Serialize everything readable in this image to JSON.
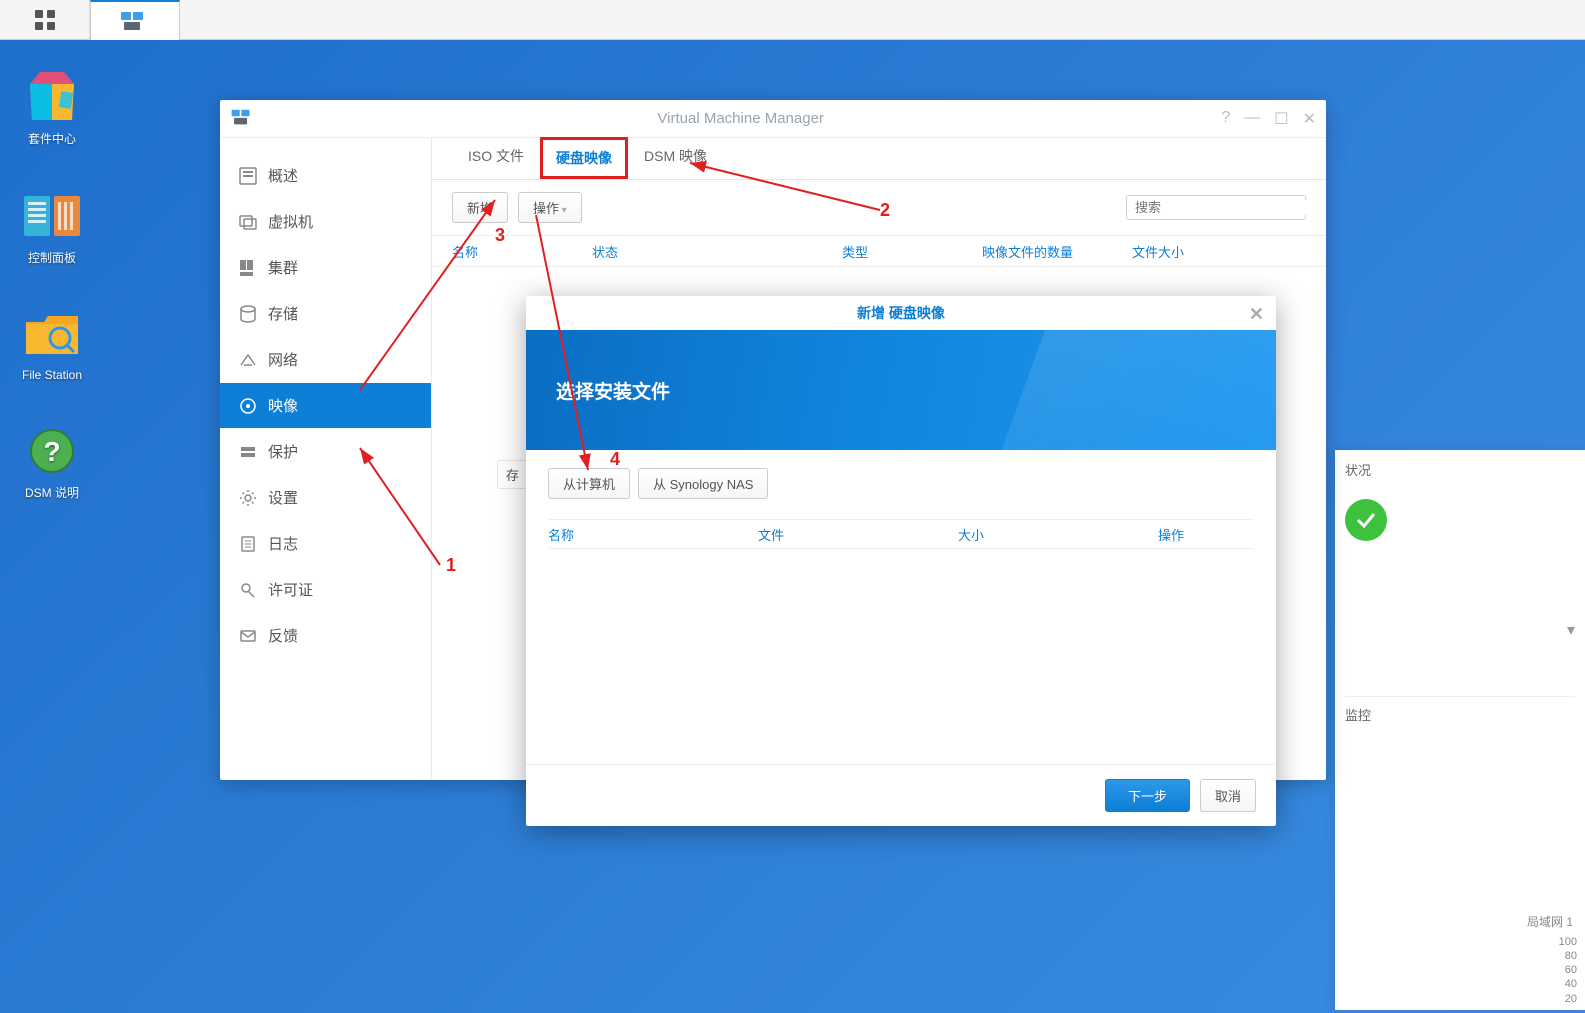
{
  "taskbar": {
    "apps_label": "Apps",
    "vmm_label": "VMM"
  },
  "desktop": {
    "package_center": "套件中心",
    "control_panel": "控制面板",
    "file_station": "File Station",
    "dsm_help": "DSM 说明"
  },
  "window": {
    "title": "Virtual Machine Manager",
    "icon_name": "vmm-app-icon"
  },
  "sidebar": {
    "items": [
      {
        "label": "概述",
        "icon": "overview-icon"
      },
      {
        "label": "虚拟机",
        "icon": "vm-icon"
      },
      {
        "label": "集群",
        "icon": "cluster-icon"
      },
      {
        "label": "存储",
        "icon": "storage-icon"
      },
      {
        "label": "网络",
        "icon": "network-icon"
      },
      {
        "label": "映像",
        "icon": "image-icon",
        "active": true
      },
      {
        "label": "保护",
        "icon": "protect-icon"
      },
      {
        "label": "设置",
        "icon": "settings-icon"
      },
      {
        "label": "日志",
        "icon": "log-icon"
      },
      {
        "label": "许可证",
        "icon": "license-icon"
      },
      {
        "label": "反馈",
        "icon": "feedback-icon"
      }
    ]
  },
  "tabs": [
    {
      "label": "ISO 文件"
    },
    {
      "label": "硬盘映像",
      "active": true,
      "highlighted": true
    },
    {
      "label": "DSM 映像"
    }
  ],
  "toolbar": {
    "add_label": "新增",
    "action_label": "操作",
    "search_placeholder": "搜索"
  },
  "table_columns": [
    "名称",
    "状态",
    "类型",
    "映像文件的数量",
    "文件大小"
  ],
  "storage_peek": "存",
  "modal": {
    "title": "新增 硬盘映像",
    "hero_title": "选择安装文件",
    "from_computer": "从计算机",
    "from_nas": "从 Synology NAS",
    "columns": [
      "名称",
      "文件",
      "大小",
      "操作"
    ],
    "next_label": "下一步",
    "cancel_label": "取消"
  },
  "annotations": {
    "num1": "1",
    "num2": "2",
    "num3": "3",
    "num4": "4"
  },
  "right_panel": {
    "status_section": "状况",
    "monitor_section": "监控",
    "network_label": "局域网 1",
    "axis_values": [
      "100",
      "80",
      "60",
      "40",
      "20"
    ]
  }
}
